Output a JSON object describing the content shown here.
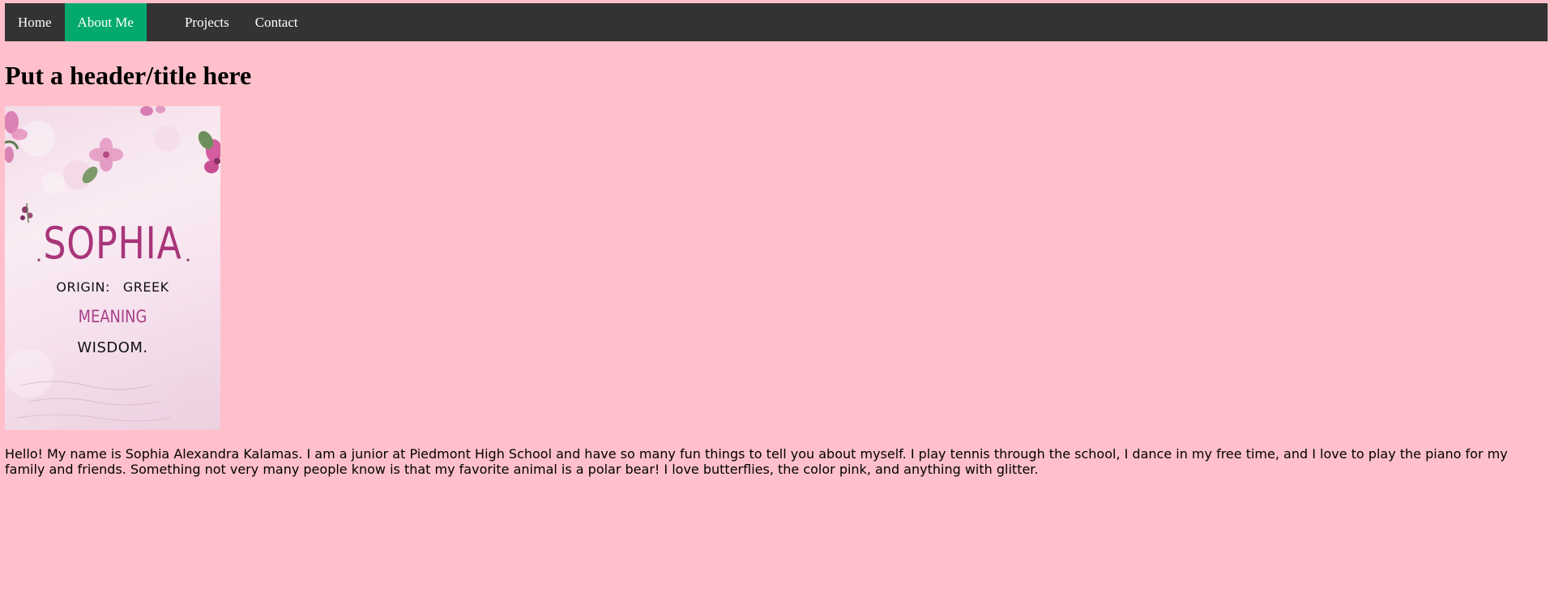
{
  "nav": {
    "items": [
      {
        "label": "Home"
      },
      {
        "label": "About Me"
      },
      {
        "label": "Projects"
      },
      {
        "label": "Contact"
      }
    ],
    "active_color": "#04aa6d",
    "bar_color": "#333333"
  },
  "page": {
    "title": "Put a header/title here",
    "background_color": "#ffc0cb"
  },
  "card": {
    "name": "SOPHIA",
    "origin_label": "ORIGIN:",
    "origin_value": "GREEK",
    "meaning_label": "MEANING",
    "meaning_value": "WISDOM.",
    "accent_color": "#a8357a"
  },
  "bio": {
    "text": "Hello! My name is Sophia Alexandra Kalamas. I am a junior at Piedmont High School and have so many fun things to tell you about myself. I play tennis through the school, I dance in my free time, and I love to play the piano for my family and friends. Something not very many people know is that my favorite animal is a polar bear! I love butterflies, the color pink, and anything with glitter."
  }
}
